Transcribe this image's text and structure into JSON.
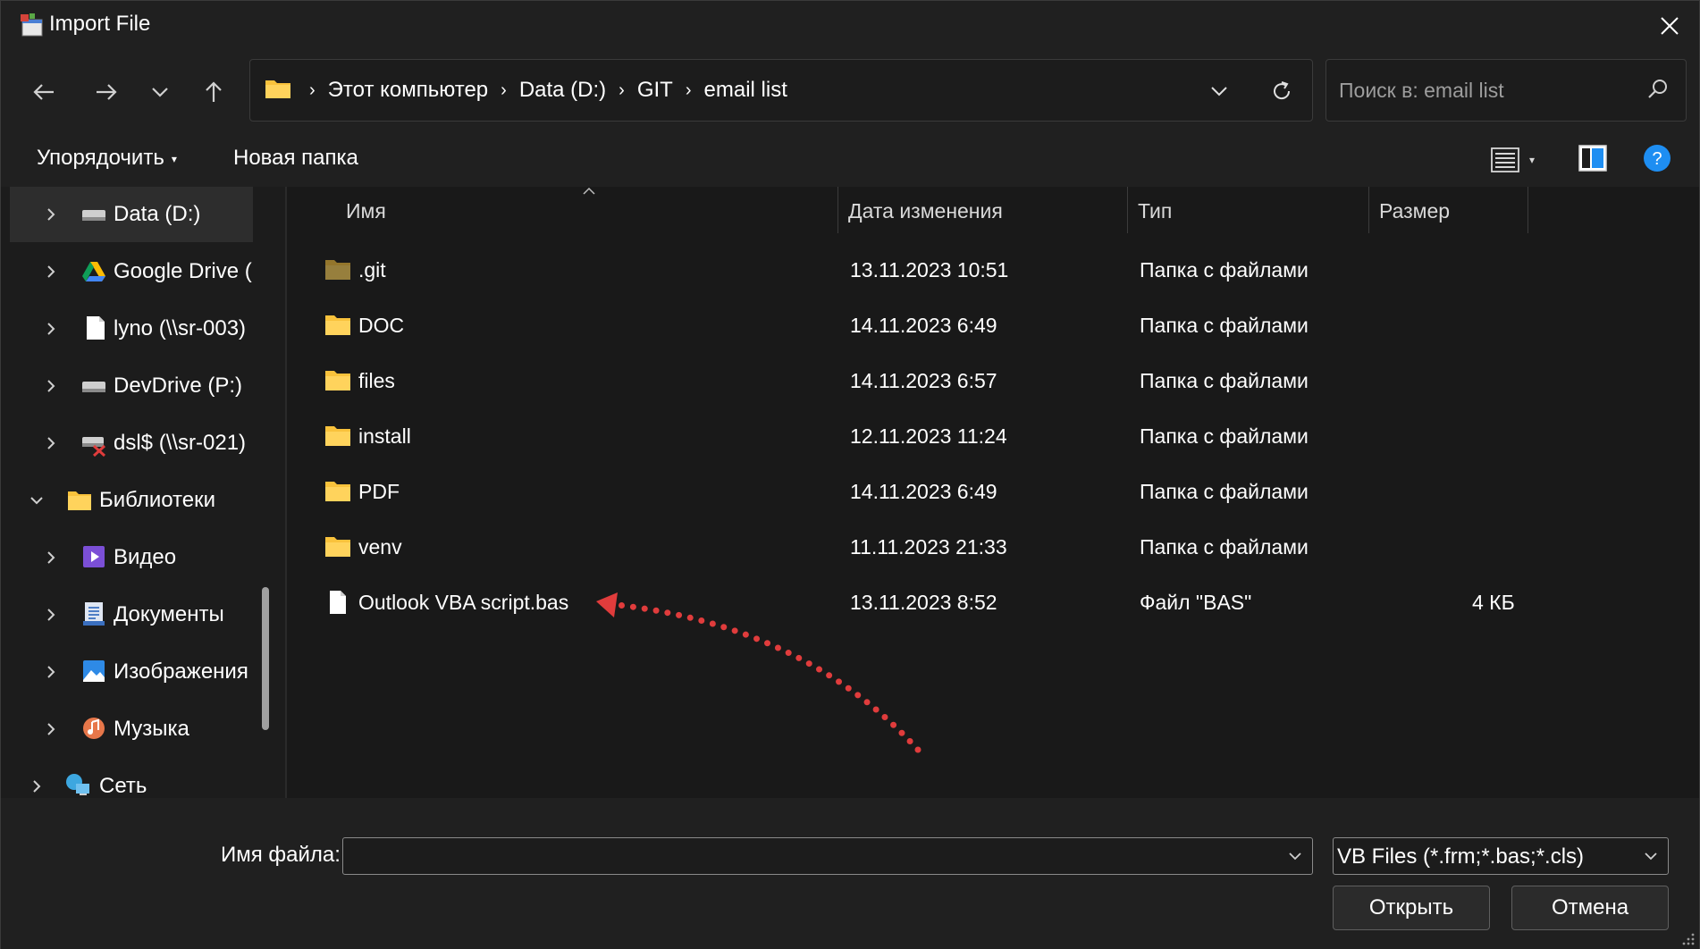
{
  "window": {
    "title": "Import File"
  },
  "address": {
    "crumbs": [
      "Этот компьютер",
      "Data (D:)",
      "GIT",
      "email list"
    ]
  },
  "search": {
    "placeholder": "Поиск в: email list"
  },
  "toolbar": {
    "organize_label": "Упорядочить",
    "new_folder_label": "Новая папка"
  },
  "sidebar": {
    "items": [
      {
        "label": "Data (D:)",
        "icon": "drive-icon",
        "level": 1,
        "expanded": false,
        "selected": true
      },
      {
        "label": "Google Drive (",
        "icon": "google-drive-icon",
        "level": 1,
        "expanded": false
      },
      {
        "label": "lyno (\\\\sr-003)",
        "icon": "file-icon",
        "level": 1,
        "expanded": false
      },
      {
        "label": "DevDrive (P:)",
        "icon": "drive-icon",
        "level": 1,
        "expanded": false
      },
      {
        "label": "dsl$ (\\\\sr-021)",
        "icon": "network-drive-disconnected-icon",
        "level": 1,
        "expanded": false
      },
      {
        "label": "Библиотеки",
        "icon": "folder-icon",
        "level": 0,
        "expanded": true
      },
      {
        "label": "Видео",
        "icon": "video-library-icon",
        "level": 1,
        "expanded": false
      },
      {
        "label": "Документы",
        "icon": "documents-library-icon",
        "level": 1,
        "expanded": false
      },
      {
        "label": "Изображения",
        "icon": "pictures-library-icon",
        "level": 1,
        "expanded": false
      },
      {
        "label": "Музыка",
        "icon": "music-library-icon",
        "level": 1,
        "expanded": false
      },
      {
        "label": "Сеть",
        "icon": "network-icon",
        "level": 0,
        "expanded": false
      }
    ]
  },
  "columns": {
    "name": "Имя",
    "date": "Дата изменения",
    "type": "Тип",
    "size": "Размер"
  },
  "files": [
    {
      "name": ".git",
      "date": "13.11.2023 10:51",
      "type": "Папка с файлами",
      "size": "",
      "kind": "folder-hidden"
    },
    {
      "name": "DOC",
      "date": "14.11.2023 6:49",
      "type": "Папка с файлами",
      "size": "",
      "kind": "folder"
    },
    {
      "name": "files",
      "date": "14.11.2023 6:57",
      "type": "Папка с файлами",
      "size": "",
      "kind": "folder"
    },
    {
      "name": "install",
      "date": "12.11.2023 11:24",
      "type": "Папка с файлами",
      "size": "",
      "kind": "folder"
    },
    {
      "name": "PDF",
      "date": "14.11.2023 6:49",
      "type": "Папка с файлами",
      "size": "",
      "kind": "folder"
    },
    {
      "name": "venv",
      "date": "11.11.2023 21:33",
      "type": "Папка с файлами",
      "size": "",
      "kind": "folder"
    },
    {
      "name": "Outlook VBA script.bas",
      "date": "13.11.2023 8:52",
      "type": "Файл \"BAS\"",
      "size": "4 КБ",
      "kind": "file"
    }
  ],
  "footer": {
    "filename_label": "Имя файла:",
    "filename_value": "",
    "filetype_value": "VB Files (*.frm;*.bas;*.cls)",
    "open_label": "Открыть",
    "cancel_label": "Отмена"
  },
  "colors": {
    "folder": "#f9c23c",
    "annotation_arrow": "#e03c3c",
    "help_blue": "#1e8ef2"
  }
}
